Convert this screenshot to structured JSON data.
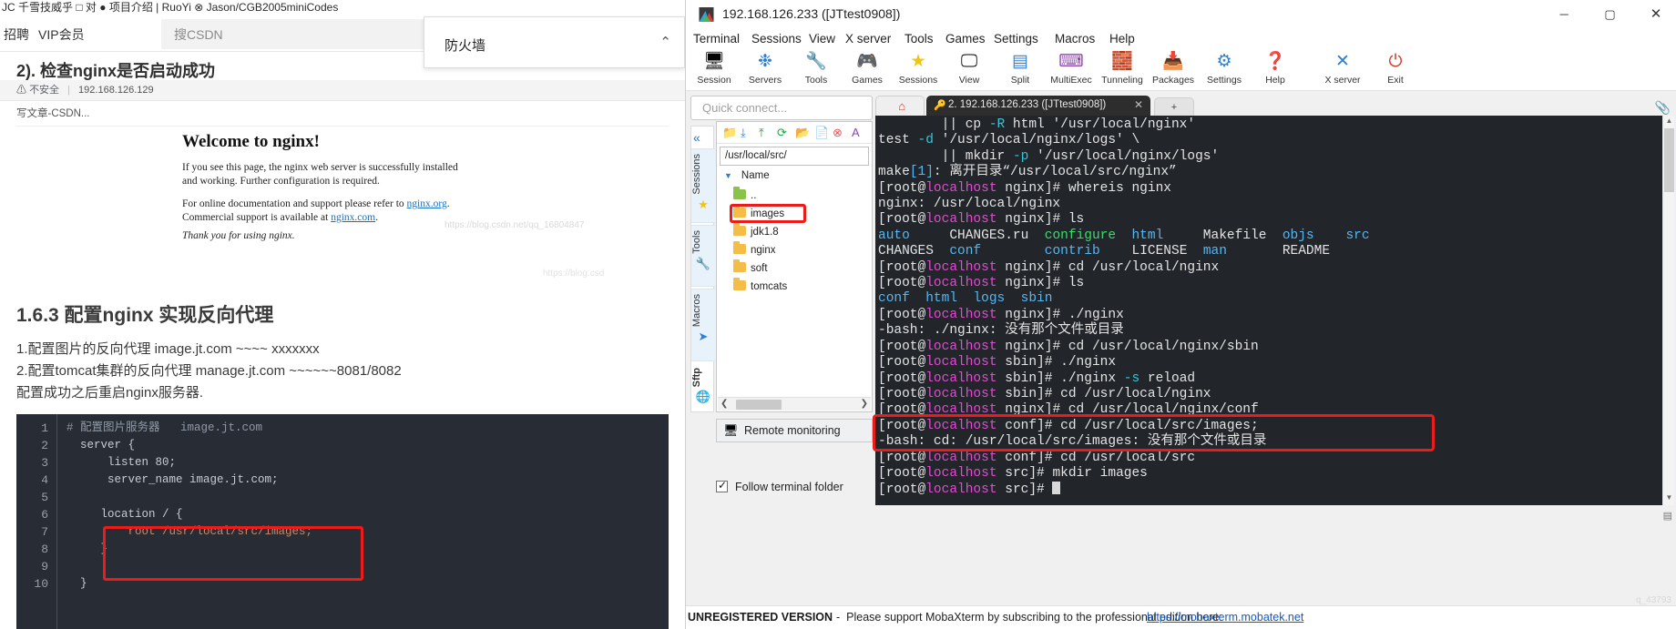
{
  "browser": {
    "bookmark_strip": "JC 千雪技威乎  □ 对  ● 项目介绍 | RuoYi  ⊗ Jason/CGB2005miniCodes",
    "bookmarks": [
      {
        "label": "招聘",
        "x": 4
      },
      {
        "label": "VIP会员",
        "x": 42
      }
    ],
    "search_placeholder": "搜CSDN",
    "firewall_popup": {
      "text": "防火墙",
      "chevron": "⌃"
    },
    "article_heading": "2). 检查nginx是否启动成功",
    "url_warning": "不安全",
    "url": "192.168.126.129",
    "tab_title": "写文章-CSDN...",
    "nginx_page": {
      "title": "Welcome to nginx!",
      "para1": "If you see this page, the nginx web server is successfully installed and working. Further configuration is required.",
      "para2_pre": "For online documentation and support please refer to ",
      "link1": "nginx.org",
      "para2_mid": ". Commercial support is available at ",
      "link2": "nginx.com",
      "para2_end": ".",
      "thanks": "Thank you for using nginx."
    },
    "watermark1": "https://blog.csdn.net/qq_16804847",
    "watermark2": "https://blog.csd",
    "section_title": "1.6.3 配置nginx 实现反向代理",
    "body_lines": [
      "1.配置图片的反向代理 image.jt.com ~~~~ xxxxxxx",
      "2.配置tomcat集群的反向代理 manage.jt.com ~~~~~~8081/8082",
      "配置成功之后重启nginx服务器."
    ],
    "code": {
      "line_numbers": [
        "1",
        "2",
        "3",
        "4",
        "5",
        "6",
        "7",
        "8",
        "9",
        "10"
      ],
      "lines": [
        "# 配置图片服务器   image.jt.com",
        "  server {",
        "      listen 80;",
        "      server_name image.jt.com;",
        "",
        "     location / {",
        "         root /usr/local/src/images;",
        "     }",
        "",
        "  }"
      ]
    }
  },
  "mobaxterm": {
    "window_title": "192.168.126.233 ([JTtest0908])",
    "window_buttons": {
      "minimize": "─",
      "maximize": "▢",
      "close": "✕"
    },
    "menus": [
      "Terminal",
      "Sessions",
      "View",
      "X server",
      "Tools",
      "Games",
      "Settings",
      "Macros",
      "Help"
    ],
    "toolbar": [
      {
        "label": "Session",
        "icon": "session-icon"
      },
      {
        "label": "Servers",
        "icon": "servers-icon"
      },
      {
        "label": "Tools",
        "icon": "tools-icon"
      },
      {
        "label": "Games",
        "icon": "games-icon"
      },
      {
        "label": "Sessions",
        "icon": "star-icon"
      },
      {
        "label": "View",
        "icon": "view-icon"
      },
      {
        "label": "Split",
        "icon": "split-icon"
      },
      {
        "label": "MultiExec",
        "icon": "multiexec-icon"
      },
      {
        "label": "Tunneling",
        "icon": "tunneling-icon"
      },
      {
        "label": "Packages",
        "icon": "packages-icon"
      },
      {
        "label": "Settings",
        "icon": "settings-icon"
      },
      {
        "label": "Help",
        "icon": "help-icon"
      },
      {
        "label": "X server",
        "icon": "xserver-icon"
      },
      {
        "label": "Exit",
        "icon": "exit-icon"
      }
    ],
    "quick_connect_placeholder": "Quick connect...",
    "side_tabs": [
      {
        "label": "Sessions",
        "icon": "star-icon"
      },
      {
        "label": "Tools",
        "icon": "tools-icon"
      },
      {
        "label": "Macros",
        "icon": "macro-icon"
      },
      {
        "label": "Sftp",
        "icon": "globe-icon"
      }
    ],
    "collapse_icon": "«",
    "sftp": {
      "path": "/usr/local/src/",
      "column_header": "Name",
      "files": [
        {
          "name": "..",
          "type": "up"
        },
        {
          "name": "images",
          "type": "folder",
          "highlighted": true
        },
        {
          "name": "jdk1.8",
          "type": "folder"
        },
        {
          "name": "nginx",
          "type": "folder"
        },
        {
          "name": "soft",
          "type": "folder"
        },
        {
          "name": "tomcats",
          "type": "folder"
        }
      ],
      "toolbar_icons": [
        "up-dir-icon",
        "download-icon",
        "upload-icon",
        "refresh-icon",
        "new-folder-icon",
        "new-file-icon",
        "delete-icon",
        "text-icon"
      ]
    },
    "remote_monitoring": "Remote monitoring",
    "follow_terminal_folder": "Follow terminal folder",
    "terminal_tab": {
      "label": "2. 192.168.126.233 ([JTtest0908])",
      "close": "✕",
      "home_icon": "home-icon",
      "plus_icon": "+"
    },
    "terminal_lines": [
      [
        {
          "t": "        || cp ",
          "c": "p1"
        },
        {
          "t": "-R",
          "c": "cyan"
        },
        {
          "t": " html '/usr/local/nginx'",
          "c": "p1"
        }
      ],
      [
        {
          "t": "test ",
          "c": "p1"
        },
        {
          "t": "-d",
          "c": "cyan"
        },
        {
          "t": " '/usr/local/nginx/logs' \\",
          "c": "p1"
        }
      ],
      [
        {
          "t": "        || mkdir ",
          "c": "p1"
        },
        {
          "t": "-p",
          "c": "cyan"
        },
        {
          "t": " '/usr/local/nginx/logs'",
          "c": "p1"
        }
      ],
      [
        {
          "t": "make",
          "c": "p1"
        },
        {
          "t": "[1]",
          "c": "dir"
        },
        {
          "t": ": 离开目录“/usr/local/src/nginx”",
          "c": "p1"
        }
      ],
      [
        {
          "t": "[root@",
          "c": "p1"
        },
        {
          "t": "localhost",
          "c": "host"
        },
        {
          "t": " nginx]# whereis nginx",
          "c": "p1"
        }
      ],
      [
        {
          "t": "nginx: /usr/local/nginx",
          "c": "p1"
        }
      ],
      [
        {
          "t": "[root@",
          "c": "p1"
        },
        {
          "t": "localhost",
          "c": "host"
        },
        {
          "t": " nginx]# ls",
          "c": "p1"
        }
      ],
      [
        {
          "t": "auto",
          "c": "dir"
        },
        {
          "t": "     CHANGES.ru  ",
          "c": "p1"
        },
        {
          "t": "configure",
          "c": "grn"
        },
        {
          "t": "  ",
          "c": "p1"
        },
        {
          "t": "html",
          "c": "dir"
        },
        {
          "t": "     Makefile  ",
          "c": "p1"
        },
        {
          "t": "objs",
          "c": "dir"
        },
        {
          "t": "    ",
          "c": "p1"
        },
        {
          "t": "src",
          "c": "dir"
        }
      ],
      [
        {
          "t": "CHANGES  ",
          "c": "p1"
        },
        {
          "t": "conf",
          "c": "dir"
        },
        {
          "t": "        ",
          "c": "p1"
        },
        {
          "t": "contrib",
          "c": "dir"
        },
        {
          "t": "    LICENSE  ",
          "c": "p1"
        },
        {
          "t": "man",
          "c": "dir"
        },
        {
          "t": "       README",
          "c": "p1"
        }
      ],
      [
        {
          "t": "[root@",
          "c": "p1"
        },
        {
          "t": "localhost",
          "c": "host"
        },
        {
          "t": " nginx]# cd /usr/local/nginx",
          "c": "p1"
        }
      ],
      [
        {
          "t": "[root@",
          "c": "p1"
        },
        {
          "t": "localhost",
          "c": "host"
        },
        {
          "t": " nginx]# ls",
          "c": "p1"
        }
      ],
      [
        {
          "t": "conf",
          "c": "dir"
        },
        {
          "t": "  ",
          "c": "p1"
        },
        {
          "t": "html",
          "c": "dir"
        },
        {
          "t": "  ",
          "c": "p1"
        },
        {
          "t": "logs",
          "c": "dir"
        },
        {
          "t": "  ",
          "c": "p1"
        },
        {
          "t": "sbin",
          "c": "dir"
        }
      ],
      [
        {
          "t": "[root@",
          "c": "p1"
        },
        {
          "t": "localhost",
          "c": "host"
        },
        {
          "t": " nginx]# ./nginx",
          "c": "p1"
        }
      ],
      [
        {
          "t": "-bash: ./nginx: 没有那个文件或目录",
          "c": "p1"
        }
      ],
      [
        {
          "t": "[root@",
          "c": "p1"
        },
        {
          "t": "localhost",
          "c": "host"
        },
        {
          "t": " nginx]# cd /usr/local/nginx/sbin",
          "c": "p1"
        }
      ],
      [
        {
          "t": "[root@",
          "c": "p1"
        },
        {
          "t": "localhost",
          "c": "host"
        },
        {
          "t": " sbin]# ./nginx",
          "c": "p1"
        }
      ],
      [
        {
          "t": "[root@",
          "c": "p1"
        },
        {
          "t": "localhost",
          "c": "host"
        },
        {
          "t": " sbin]# ./nginx ",
          "c": "p1"
        },
        {
          "t": "-s",
          "c": "cyan"
        },
        {
          "t": " reload",
          "c": "p1"
        }
      ],
      [
        {
          "t": "[root@",
          "c": "p1"
        },
        {
          "t": "localhost",
          "c": "host"
        },
        {
          "t": " sbin]# cd /usr/local/nginx",
          "c": "p1"
        }
      ],
      [
        {
          "t": "[root@",
          "c": "p1"
        },
        {
          "t": "localhost",
          "c": "host"
        },
        {
          "t": " nginx]# cd /usr/local/nginx/conf",
          "c": "p1"
        }
      ],
      [
        {
          "t": "[root@",
          "c": "p1"
        },
        {
          "t": "localhost",
          "c": "host"
        },
        {
          "t": " conf]# cd /usr/local/src/images;",
          "c": "p1"
        }
      ],
      [
        {
          "t": "-bash: cd: /usr/local/src/images: 没有那个文件或目录",
          "c": "p1"
        }
      ],
      [
        {
          "t": "[root@",
          "c": "p1"
        },
        {
          "t": "localhost",
          "c": "host"
        },
        {
          "t": " conf]# cd /usr/local/src",
          "c": "p1"
        }
      ],
      [
        {
          "t": "[root@",
          "c": "p1"
        },
        {
          "t": "localhost",
          "c": "host"
        },
        {
          "t": " src]# mkdir images",
          "c": "p1"
        }
      ],
      [
        {
          "t": "[root@",
          "c": "p1"
        },
        {
          "t": "localhost",
          "c": "host"
        },
        {
          "t": " src]# ",
          "c": "p1"
        }
      ]
    ],
    "footer": {
      "unregistered": "UNREGISTERED VERSION",
      "dash": "-",
      "message": "Please support MobaXterm by subscribing to the professional edition here:",
      "link": "https://mobaxterm.mobatek.net",
      "watermark": "q_43793"
    }
  },
  "colors": {
    "accent_red": "#ee1b1b",
    "terminal_bg": "#22262b",
    "prompt_host": "#e24ad0",
    "dir_blue": "#56b6f0",
    "exec_green": "#3fd96b",
    "flag_cyan": "#36c4d8",
    "link_blue": "#1459c4"
  }
}
